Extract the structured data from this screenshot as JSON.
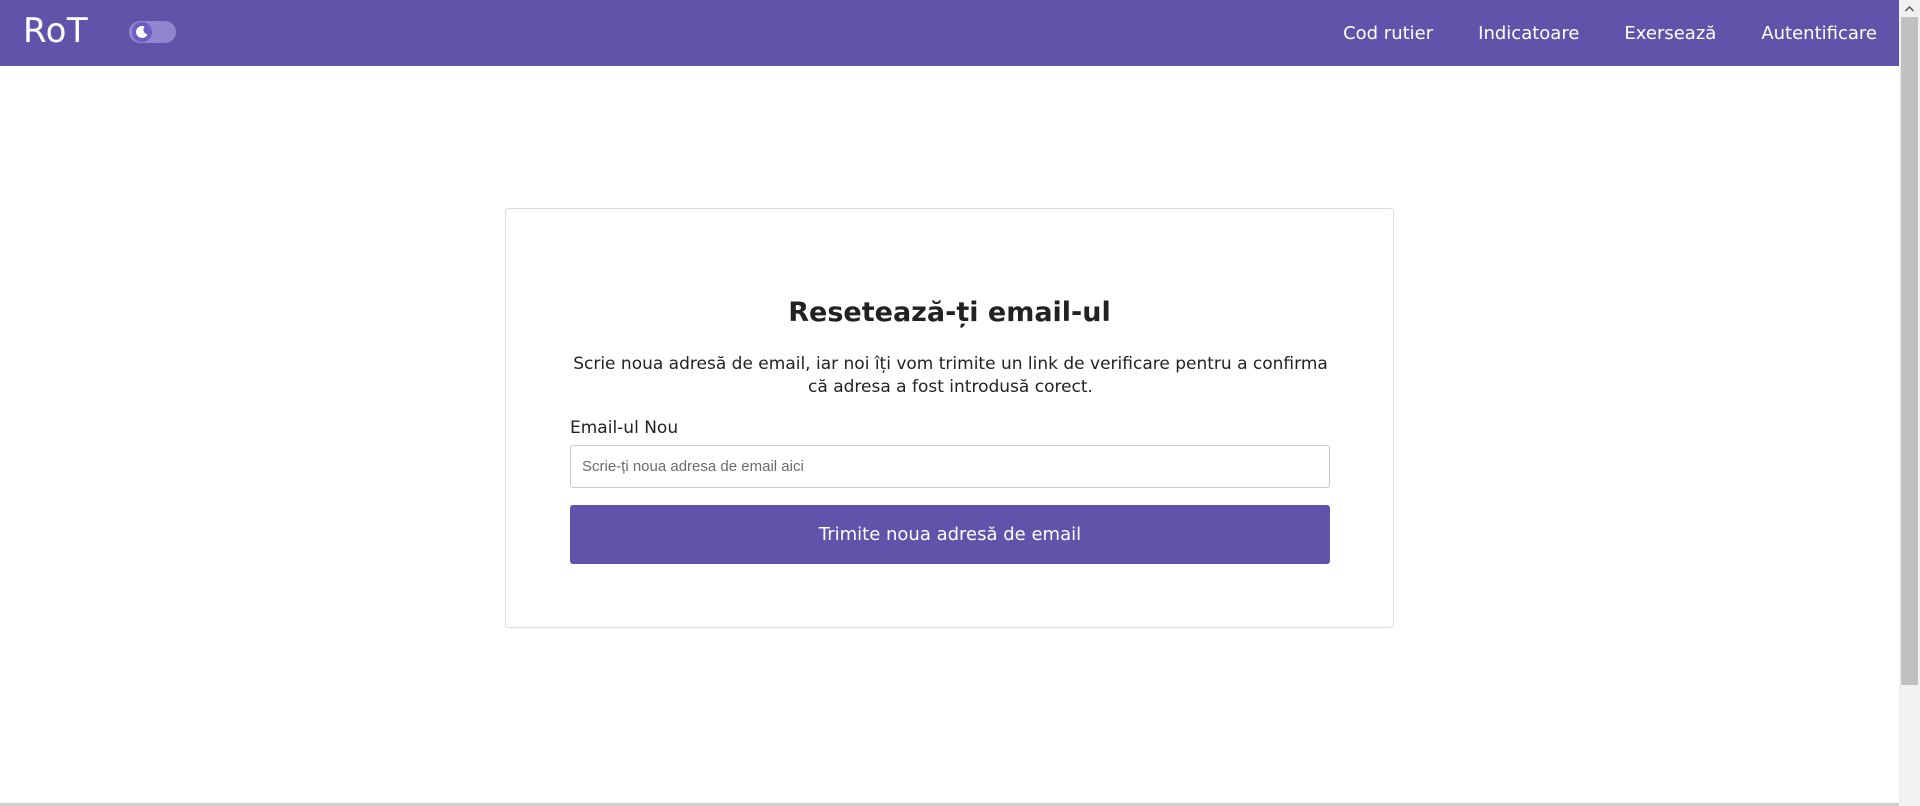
{
  "navbar": {
    "brand": "RoT",
    "theme_toggle_icon": "moon-icon",
    "links": [
      {
        "label": "Cod rutier"
      },
      {
        "label": "Indicatoare"
      },
      {
        "label": "Exersează"
      },
      {
        "label": "Autentificare"
      }
    ]
  },
  "card": {
    "title": "Resetează-ți email-ul",
    "description": "Scrie noua adresă de email, iar noi îți vom trimite un link de verificare pentru a confirma că adresa a fost introdusă corect.",
    "field_label": "Email-ul Nou",
    "input_value": "",
    "input_placeholder": "Scrie-ți noua adresa de email aici",
    "submit_label": "Trimite noua adresă de email"
  },
  "colors": {
    "accent": "#6153aa",
    "toggle_track": "#8f86cf"
  }
}
